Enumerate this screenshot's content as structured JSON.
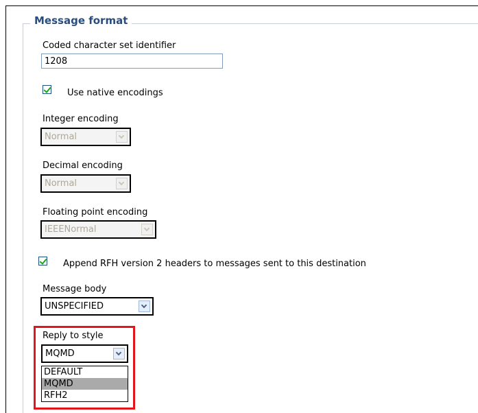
{
  "fieldset": {
    "legend": "Message format"
  },
  "ccsid": {
    "label": "Coded character set identifier",
    "value": "1208"
  },
  "native_encodings": {
    "label": "Use native encodings",
    "checked": true
  },
  "integer_encoding": {
    "label": "Integer encoding",
    "value": "Normal",
    "disabled": true
  },
  "decimal_encoding": {
    "label": "Decimal encoding",
    "value": "Normal",
    "disabled": true
  },
  "floating_point_encoding": {
    "label": "Floating point encoding",
    "value": "IEEENormal",
    "disabled": true
  },
  "append_rfh2": {
    "label": "Append RFH version 2 headers to messages sent to this destination",
    "checked": true
  },
  "message_body": {
    "label": "Message body",
    "value": "UNSPECIFIED"
  },
  "reply_to_style": {
    "label": "Reply to style",
    "value": "MQMD",
    "options": [
      "DEFAULT",
      "MQMD",
      "RFH2"
    ],
    "highlighted_option": "MQMD"
  },
  "colors": {
    "legend": "#2a4d7f",
    "highlight_border": "#e0161b",
    "checkmark": "#21a121"
  }
}
